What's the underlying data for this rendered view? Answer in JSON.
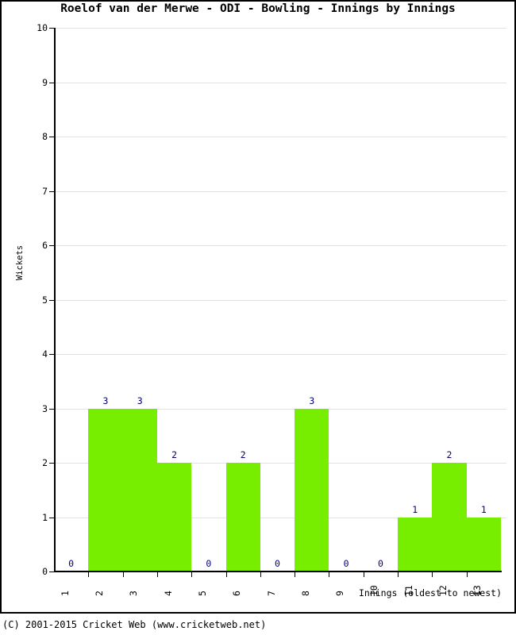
{
  "chart_data": {
    "type": "bar",
    "title": "Roelof van der Merwe - ODI - Bowling - Innings by Innings",
    "xlabel": "Innings (oldest to newest)",
    "ylabel": "Wickets",
    "categories": [
      "1",
      "2",
      "3",
      "4",
      "5",
      "6",
      "7",
      "8",
      "9",
      "10",
      "11",
      "12",
      "13"
    ],
    "values": [
      0,
      3,
      3,
      2,
      0,
      2,
      0,
      3,
      0,
      0,
      1,
      2,
      1
    ],
    "ylim": [
      0,
      10
    ],
    "yticks": [
      "0",
      "1",
      "2",
      "3",
      "4",
      "5",
      "6",
      "7",
      "8",
      "9",
      "10"
    ],
    "grid": true,
    "legend": false,
    "bar_color": "#77ee00",
    "label_color": "#00007f",
    "gridline_color": "#e2e2e2",
    "axis_color": "#000000"
  },
  "footer": {
    "copyright": "(C) 2001-2015 Cricket Web (www.cricketweb.net)"
  }
}
